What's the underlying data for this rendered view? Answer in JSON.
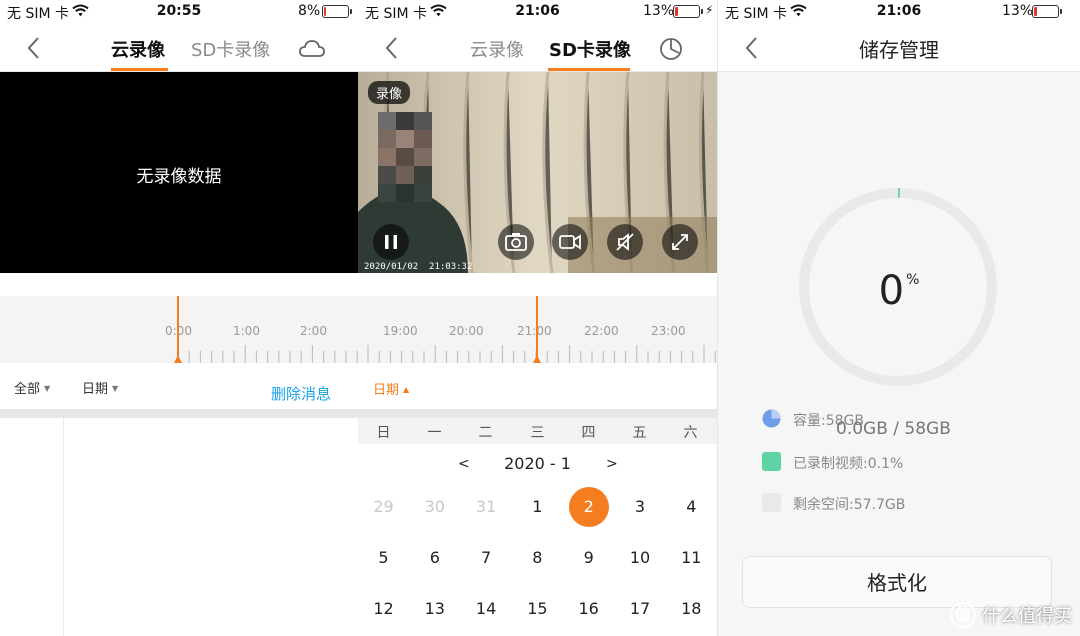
{
  "panel_cloud": {
    "status": {
      "carrier": "无 SIM 卡",
      "time": "20:55",
      "battery": "8%"
    },
    "tabs": [
      {
        "label": "云录像"
      },
      {
        "label": "SD卡录像"
      }
    ],
    "video_empty": "无录像数据",
    "timeline_labels": [
      "0:00",
      "1:00",
      "2:00"
    ],
    "filters": [
      {
        "label": "全部"
      },
      {
        "label": "日期"
      }
    ],
    "delete_label": "删除消息",
    "battery_level": 0.08,
    "nav_icon": "cloud-icon"
  },
  "panel_sd": {
    "status": {
      "carrier": "无 SIM 卡",
      "time": "21:06",
      "battery": "13%"
    },
    "tabs": [
      {
        "label": "云录像"
      },
      {
        "label": "SD卡录像"
      }
    ],
    "badge": "录像",
    "timestamp": "2020/01/02  21:03:32",
    "controls": [
      "pause-icon",
      "camera-icon",
      "video-record-icon",
      "mute-icon",
      "fullscreen-icon"
    ],
    "timeline_labels": [
      "19:00",
      "20:00",
      "21:00",
      "22:00",
      "23:00"
    ],
    "filter_date": "日期",
    "weekdays": [
      "日",
      "一",
      "二",
      "三",
      "四",
      "五",
      "六"
    ],
    "month": {
      "prev": "<",
      "label": "2020 - 1",
      "next": ">"
    },
    "days": [
      {
        "d": "29",
        "dim": true
      },
      {
        "d": "30",
        "dim": true
      },
      {
        "d": "31",
        "dim": true
      },
      {
        "d": "1"
      },
      {
        "d": "2",
        "selected": true
      },
      {
        "d": "3"
      },
      {
        "d": "4"
      },
      {
        "d": "5"
      },
      {
        "d": "6"
      },
      {
        "d": "7"
      },
      {
        "d": "8"
      },
      {
        "d": "9"
      },
      {
        "d": "10"
      },
      {
        "d": "11"
      },
      {
        "d": "12"
      },
      {
        "d": "13"
      },
      {
        "d": "14"
      },
      {
        "d": "15"
      },
      {
        "d": "16"
      },
      {
        "d": "17"
      },
      {
        "d": "18"
      }
    ],
    "battery_level": 0.13,
    "nav_icon": "clock-history-icon"
  },
  "panel_storage": {
    "status": {
      "carrier": "无 SIM 卡",
      "time": "21:06",
      "battery": "13%"
    },
    "title": "储存管理",
    "percent": "0",
    "percent_unit": "%",
    "used_fraction": 0.001,
    "legend": [
      {
        "label": "容量:58GB",
        "color": "#6f9ee8"
      },
      {
        "label": "已录制视频:0.1%",
        "color": "#5ed3a4"
      },
      {
        "label": "剩余空间:57.7GB",
        "color": "#e9e9e9"
      }
    ],
    "usage": "0.0GB / 58GB",
    "format_button": "格式化",
    "battery_level": 0.13
  },
  "watermark": {
    "logo": "值",
    "text": "什么值得买"
  },
  "colors": {
    "accent": "#f47d20",
    "link": "#1aa3e6",
    "ring": "#e9e9e9"
  }
}
